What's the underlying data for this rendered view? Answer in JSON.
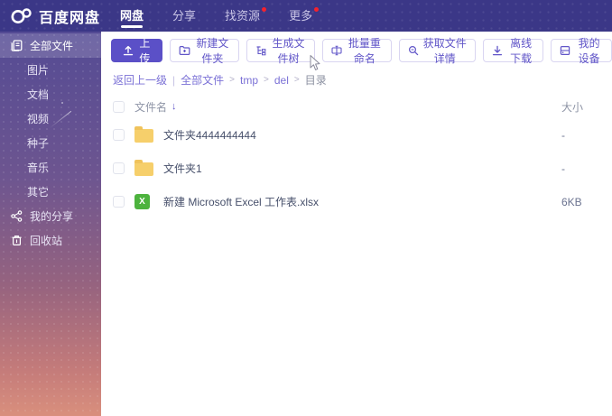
{
  "topbar": {
    "logo_text": "百度网盘",
    "tabs": [
      {
        "label": "网盘",
        "active": true,
        "has_badge": false
      },
      {
        "label": "分享",
        "active": false,
        "has_badge": false
      },
      {
        "label": "找资源",
        "active": false,
        "has_badge": true
      },
      {
        "label": "更多",
        "active": false,
        "has_badge": true
      }
    ]
  },
  "sidebar": {
    "items": [
      {
        "label": "全部文件",
        "icon": "all-files-icon",
        "active": true
      },
      {
        "label": "图片"
      },
      {
        "label": "文档"
      },
      {
        "label": "视频"
      },
      {
        "label": "种子"
      },
      {
        "label": "音乐"
      },
      {
        "label": "其它"
      },
      {
        "label": "我的分享",
        "icon": "share-icon"
      },
      {
        "label": "回收站",
        "icon": "trash-icon"
      }
    ]
  },
  "toolbar": {
    "upload": {
      "label": "上传",
      "icon": "upload-icon"
    },
    "buttons": [
      {
        "label": "新建文件夹",
        "icon": "new-folder-icon"
      },
      {
        "label": "生成文件树",
        "icon": "file-tree-icon"
      },
      {
        "label": "批量重命名",
        "icon": "batch-rename-icon"
      },
      {
        "label": "获取文件详情",
        "icon": "file-details-icon"
      },
      {
        "label": "离线下载",
        "icon": "offline-download-icon"
      },
      {
        "label": "我的设备",
        "icon": "my-devices-icon"
      }
    ]
  },
  "breadcrumb": {
    "back_label": "返回上一级",
    "divider": "|",
    "separator": ">",
    "path": [
      "全部文件",
      "tmp",
      "del",
      "目录"
    ]
  },
  "file_table": {
    "headers": {
      "name": "文件名",
      "size": "大小"
    },
    "sort": {
      "column": "文件名",
      "direction": "desc",
      "glyph": "↓"
    },
    "excel_icon_letter": "X",
    "rows": [
      {
        "name": "文件夹4444444444",
        "type": "folder",
        "size": "-"
      },
      {
        "name": "文件夹1",
        "type": "folder",
        "size": "-"
      },
      {
        "name": "新建 Microsoft Excel 工作表.xlsx",
        "type": "excel",
        "size": "6KB"
      }
    ]
  },
  "colors": {
    "topbar_bg": "#3b3787",
    "sidebar_gradient_top": "#544b94",
    "sidebar_gradient_bottom": "#d98f7d",
    "active_item_bg": "rgba(255,255,255,0.16)",
    "accent_purple": "#5b50c7",
    "badge_red": "#f5222d",
    "folder_yellow": "#f6cf6b",
    "excel_green": "#4db33e"
  }
}
